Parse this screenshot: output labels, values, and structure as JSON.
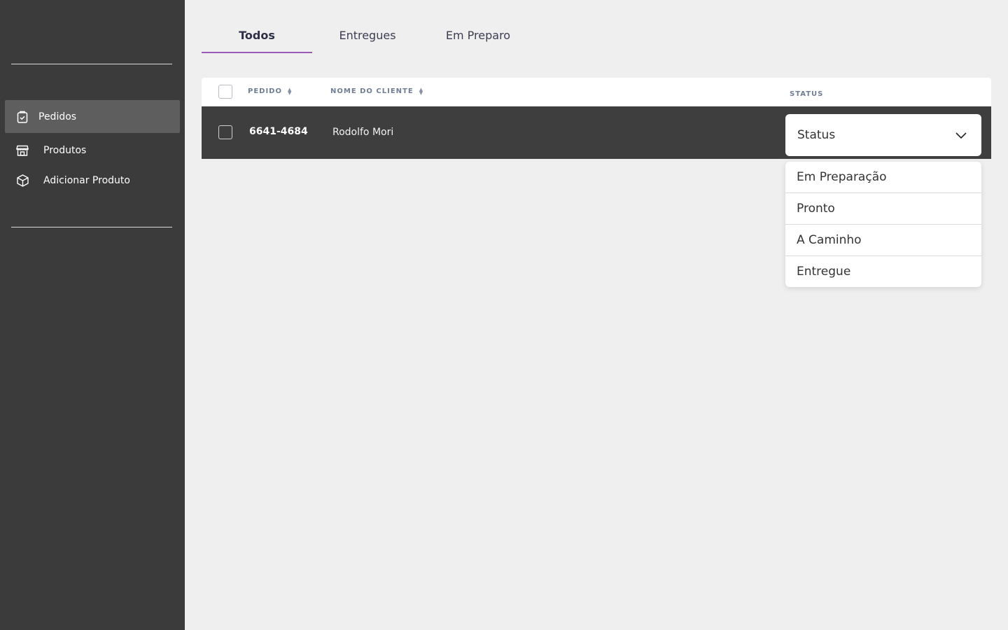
{
  "sidebar": {
    "items": [
      {
        "label": "Pedidos",
        "icon": "clipboard-check-icon",
        "active": true
      },
      {
        "label": "Produtos",
        "icon": "store-icon",
        "active": false
      },
      {
        "label": "Adicionar Produto",
        "icon": "box-icon",
        "active": false
      }
    ]
  },
  "tabs": [
    {
      "label": "Todos",
      "active": true
    },
    {
      "label": "Entregues",
      "active": false
    },
    {
      "label": "Em Preparo",
      "active": false
    }
  ],
  "table": {
    "columns": {
      "pedido": "PEDIDO",
      "cliente": "NOME DO CLIENTE",
      "status": "STATUS"
    },
    "rows": [
      {
        "pedido": "6641-4684",
        "cliente": "Rodolfo Mori",
        "status": "Status"
      }
    ]
  },
  "status_dropdown": {
    "selected": "Status",
    "options": [
      "Em Preparação",
      "Pronto",
      "A Caminho",
      "Entregue"
    ]
  },
  "colors": {
    "sidebar_bg": "#3b3b3b",
    "sidebar_active": "#5e5e5e",
    "tab_accent": "#9b59b6",
    "page_bg": "#efefef",
    "row_bg": "#3e3e3e"
  }
}
